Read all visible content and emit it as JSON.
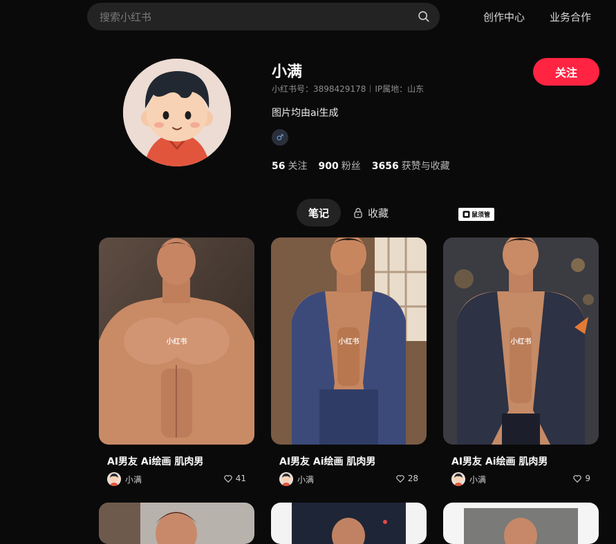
{
  "header": {
    "search_placeholder": "搜索小红书",
    "nav": [
      "创作中心",
      "业务合作"
    ]
  },
  "profile": {
    "name": "小满",
    "id_label": "小红书号：3898429178",
    "ip_label": "IP属地：山东",
    "bio": "图片均由ai生成",
    "gender_symbol": "♂",
    "stats": [
      {
        "num": "56",
        "label": "关注"
      },
      {
        "num": "900",
        "label": "粉丝"
      },
      {
        "num": "3656",
        "label": "获赞与收藏"
      }
    ],
    "follow_label": "关注"
  },
  "tabs": {
    "notes": "笔记",
    "collect": "收藏"
  },
  "badge": {
    "logo_text": "鼠须管"
  },
  "notes": [
    {
      "title": "AI男友 Ai绘画 肌肉男",
      "author": "小满",
      "likes": "41",
      "watermark": "小红书"
    },
    {
      "title": "AI男友 Ai绘画 肌肉男",
      "author": "小满",
      "likes": "28",
      "watermark": "小红书"
    },
    {
      "title": "AI男友 Ai绘画 肌肉男",
      "author": "小满",
      "likes": "9",
      "watermark": "小红书"
    }
  ],
  "colors": {
    "accent": "#ff2442",
    "background": "#0a0a0a"
  }
}
